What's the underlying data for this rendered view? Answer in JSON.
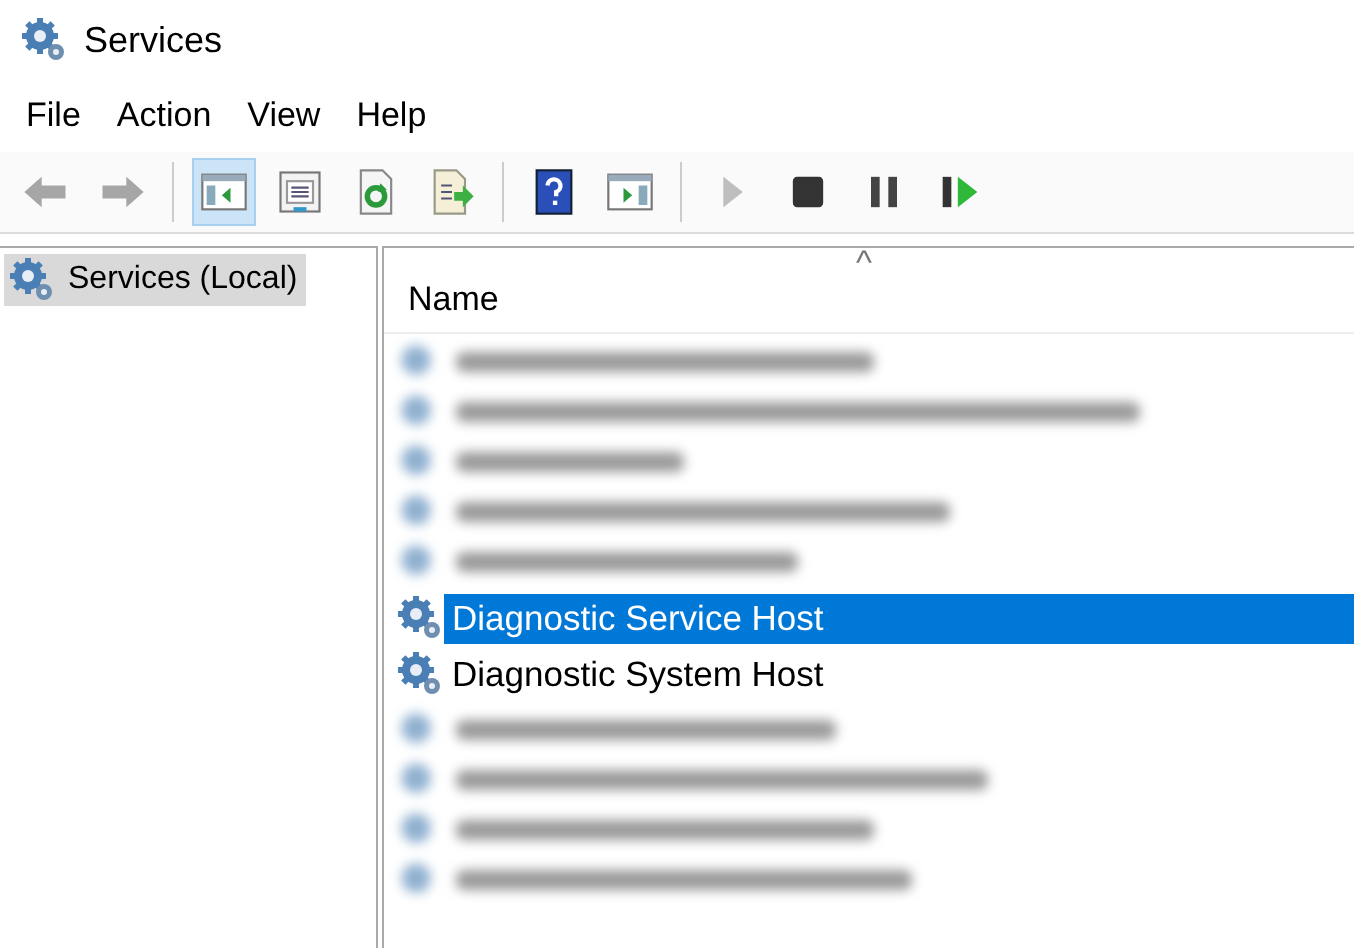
{
  "window": {
    "title": "Services"
  },
  "menu": [
    "File",
    "Action",
    "View",
    "Help"
  ],
  "toolbar": [
    {
      "kind": "back",
      "disabled": true,
      "selected": false
    },
    {
      "kind": "forward",
      "disabled": true,
      "selected": false
    },
    {
      "kind": "separator"
    },
    {
      "kind": "tree",
      "disabled": false,
      "selected": true
    },
    {
      "kind": "properties",
      "disabled": false,
      "selected": false
    },
    {
      "kind": "refresh",
      "disabled": false,
      "selected": false
    },
    {
      "kind": "export",
      "disabled": false,
      "selected": false
    },
    {
      "kind": "separator"
    },
    {
      "kind": "help",
      "disabled": false,
      "selected": false
    },
    {
      "kind": "actionpane",
      "disabled": false,
      "selected": false
    },
    {
      "kind": "separator"
    },
    {
      "kind": "play",
      "disabled": true,
      "selected": false
    },
    {
      "kind": "stop",
      "disabled": false,
      "selected": false
    },
    {
      "kind": "pause",
      "disabled": false,
      "selected": false
    },
    {
      "kind": "resume",
      "disabled": false,
      "selected": false
    }
  ],
  "tree": {
    "items": [
      {
        "label": "Services (Local)",
        "selected": true
      }
    ]
  },
  "table": {
    "columns": [
      {
        "label": "Name",
        "sort_caret": "^"
      }
    ],
    "rows": [
      {
        "kind": "blurred"
      },
      {
        "kind": "blurred"
      },
      {
        "kind": "blurred"
      },
      {
        "kind": "blurred"
      },
      {
        "kind": "blurred"
      },
      {
        "kind": "service",
        "name": "Diagnostic Service Host",
        "selected": true
      },
      {
        "kind": "service",
        "name": "Diagnostic System Host",
        "selected": false
      },
      {
        "kind": "blurred"
      },
      {
        "kind": "blurred"
      },
      {
        "kind": "blurred"
      },
      {
        "kind": "blurred"
      }
    ]
  }
}
